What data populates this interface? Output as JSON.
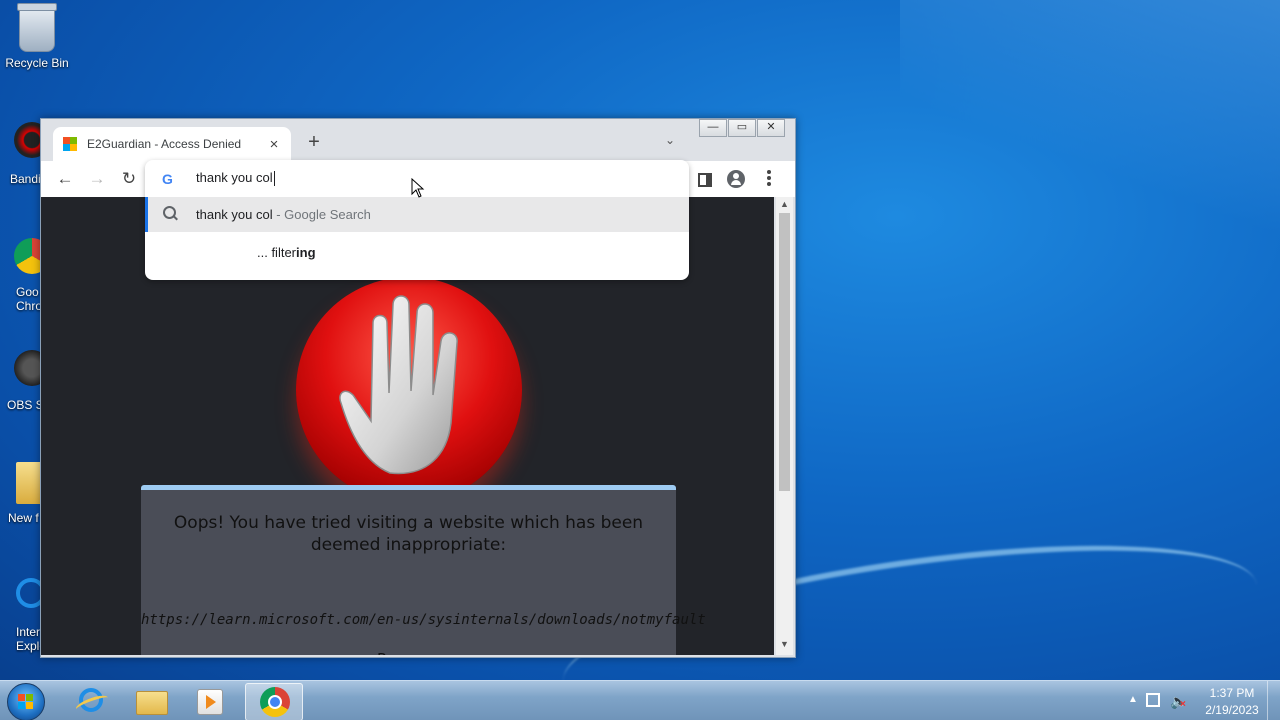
{
  "desktop": {
    "icons": [
      {
        "label": "Recycle Bin"
      },
      {
        "label": "Bandi"
      },
      {
        "label": "Goo\nChro"
      },
      {
        "label": "OBS S"
      },
      {
        "label": "New f"
      },
      {
        "label": "Inter\nExplo"
      }
    ]
  },
  "browser": {
    "tab": {
      "title": "E2Guardian - Access Denied",
      "close": "×"
    },
    "new_tab": "+",
    "tab_search": "⌄",
    "window_buttons": {
      "minimize": "—",
      "restore": "▭",
      "close": "✕"
    },
    "nav": {
      "back": "←",
      "forward": "→",
      "reload": "↻"
    },
    "omnibox": {
      "input_value": "thank you col",
      "suggestion_query": "thank you col",
      "suggestion_suffix": " - Google Search",
      "suggestion2_prefix": "... filter",
      "suggestion2_bold": "ing"
    },
    "page": {
      "heading": "Oops! You have tried visiting a website which has been deemed inappropriate:",
      "blocked_url": "https://learn.microsoft.com/en-us/sysinternals/downloads/notmyfault",
      "partial_text": "R"
    },
    "scroll": {
      "up": "▲",
      "down": "▼"
    }
  },
  "taskbar": {
    "time": "1:37 PM",
    "date": "2/19/2023",
    "tray_arrow": "▲"
  },
  "colors": {
    "desktop": "#0f67c4",
    "page_bg": "#222429",
    "notice_bg": "#4a4d57",
    "stop_red": "#e01010",
    "accent_blue": "#1a73e8"
  },
  "icons": [
    "recycle-bin-icon",
    "google-g-icon",
    "search-icon",
    "stop-hand-icon",
    "windows-start-icon",
    "internet-explorer-icon",
    "file-explorer-icon",
    "media-player-icon",
    "chrome-icon",
    "network-icon",
    "volume-muted-icon"
  ]
}
